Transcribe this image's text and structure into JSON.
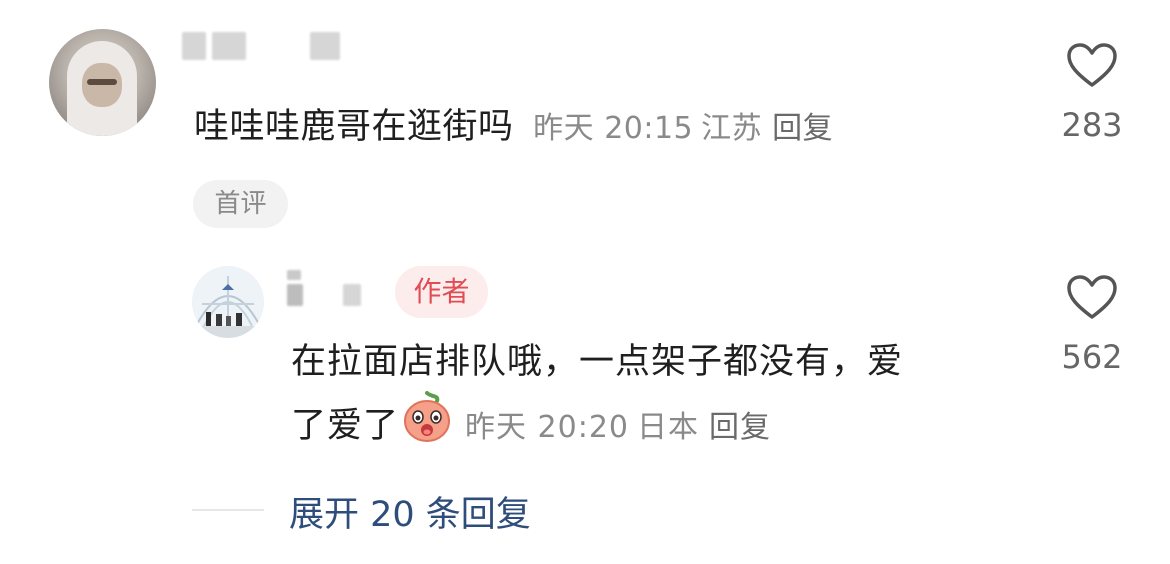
{
  "comment": {
    "text": "哇哇哇鹿哥在逛街吗",
    "time": "昨天 20:15",
    "location": "江苏",
    "reply_label": "回复",
    "badge": "首评",
    "like_count": "283"
  },
  "reply": {
    "author_badge": "作者",
    "text_line1": "在拉面店排队哦，一点架子都没有，爱",
    "text_line2": "了爱了",
    "time": "昨天 20:20",
    "location": "日本",
    "reply_label": "回复",
    "like_count": "562"
  },
  "expand_replies": "展开 20 条回复",
  "icons": {
    "like": "heart-outline-icon",
    "emoji": "peach-surprised-emoji-icon"
  },
  "colors": {
    "author_badge_bg": "#fdecec",
    "author_badge_text": "#e04d55",
    "link": "#2f4d7a",
    "meta": "#8a8a8a"
  }
}
